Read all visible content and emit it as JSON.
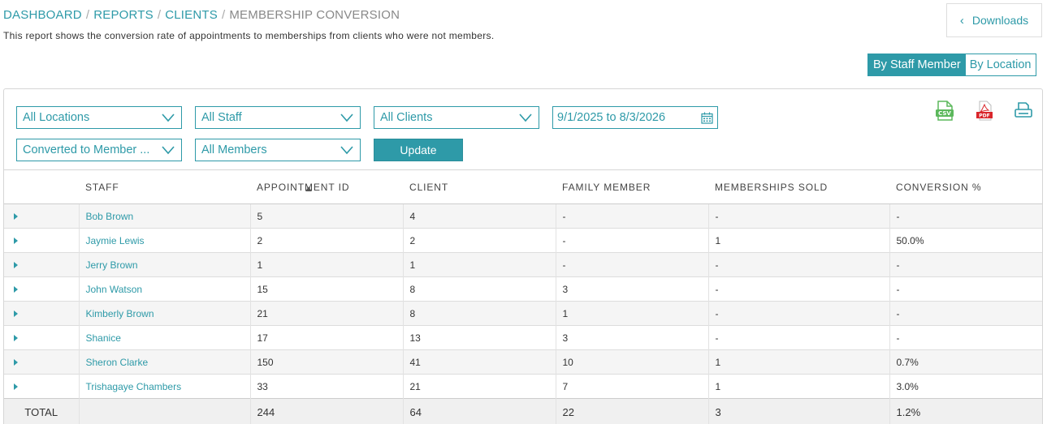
{
  "breadcrumb": [
    {
      "label": "DASHBOARD",
      "link": true
    },
    {
      "label": "REPORTS",
      "link": true
    },
    {
      "label": "CLIENTS",
      "link": true
    },
    {
      "label": "MEMBERSHIP CONVERSION",
      "link": false
    }
  ],
  "description": "This report shows the conversion rate of appointments to memberships from clients who were not members.",
  "downloads_label": "Downloads",
  "view_toggle": {
    "staff": "By Staff Member",
    "location": "By Location",
    "active": "staff"
  },
  "filters": {
    "location": "All Locations",
    "staff": "All Staff",
    "clients": "All Clients",
    "date_range": "9/1/2025 to 8/3/2026",
    "conversion": "Converted to Member ...",
    "members": "All Members",
    "update_label": "Update"
  },
  "icons": {
    "csv": "csv-export-icon",
    "pdf": "pdf-export-icon",
    "print": "print-icon",
    "calendar": "calendar-icon"
  },
  "colors": {
    "accent": "#2e9aa8",
    "csv": "#5cb85c",
    "pdf": "#d9262b"
  },
  "table": {
    "headers": [
      "STAFF",
      "APPOINTMENT ID",
      "CLIENT",
      "FAMILY MEMBER",
      "MEMBERSHIPS SOLD",
      "CONVERSION %"
    ],
    "rows": [
      [
        "Bob Brown",
        "5",
        "4",
        "-",
        "-",
        "-"
      ],
      [
        "Jaymie Lewis",
        "2",
        "2",
        "-",
        "1",
        "50.0%"
      ],
      [
        "Jerry Brown",
        "1",
        "1",
        "-",
        "-",
        "-"
      ],
      [
        "John Watson",
        "15",
        "8",
        "3",
        "-",
        "-"
      ],
      [
        "Kimberly Brown",
        "21",
        "8",
        "1",
        "-",
        "-"
      ],
      [
        "Shanice",
        "17",
        "13",
        "3",
        "-",
        "-"
      ],
      [
        "Sheron Clarke",
        "150",
        "41",
        "10",
        "1",
        "0.7%"
      ],
      [
        "Trishagaye Chambers",
        "33",
        "21",
        "7",
        "1",
        "3.0%"
      ]
    ],
    "total": {
      "label": "TOTAL",
      "values": [
        "244",
        "64",
        "22",
        "3",
        "1.2%"
      ]
    }
  }
}
